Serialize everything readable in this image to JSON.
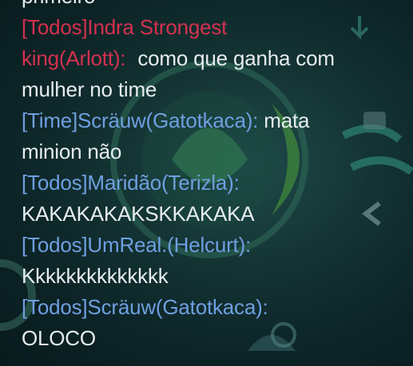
{
  "chat": {
    "cut_top": "primeiro",
    "messages": [
      {
        "channel_sender_line1": "[Todos]Indra Strongest",
        "channel_sender_line2": "king(Arlott):",
        "text_line1": "como que ganha com",
        "text_line2": "mulher no time",
        "sender_color": "#d4314f"
      },
      {
        "channel_sender": "[Time]Scräuw(Gatotkaca):",
        "text_line1": "mata",
        "text_line2": "minion não",
        "sender_color": "#6f9fe0"
      },
      {
        "channel_sender": "[Todos]Maridão(Terizla):",
        "text": "KAKAKAKAKSKKAKAKA",
        "sender_color": "#6f9fe0"
      },
      {
        "channel_sender": "[Todos]UmReal.(Helcurt):",
        "text": "Kkkkkkkkkkkkkk",
        "sender_color": "#6f9fe0"
      },
      {
        "channel_sender": "[Todos]Scräuw(Gatotkaca):",
        "text": "OLOCO",
        "sender_color": "#6f9fe0"
      }
    ]
  },
  "colors": {
    "text": "#e6ecee",
    "red_sender": "#d4314f",
    "blue_sender": "#6f9fe0",
    "background": "#0c2326"
  }
}
